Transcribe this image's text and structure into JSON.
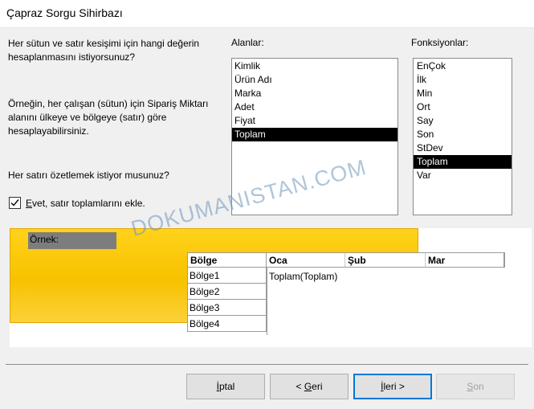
{
  "window": {
    "title": "Çapraz Sorgu Sihirbazı"
  },
  "instructions": {
    "question": "Her sütun ve satır kesişimi için hangi değerin hesaplanmasını istiyorsunuz?",
    "example": "Örneğin, her çalışan (sütun) için Sipariş Miktarı alanını ülkeye ve bölgeye (satır) göre hesaplayabilirsiniz.",
    "summarize_question": "Her satırı özetlemek istiyor musunuz?"
  },
  "fields": {
    "label": "Alanlar:",
    "items": [
      "Kimlik",
      "Ürün Adı",
      "Marka",
      "Adet",
      "Fiyat",
      "Toplam"
    ],
    "selected": "Toplam"
  },
  "functions": {
    "label": "Fonksiyonlar:",
    "items": [
      "EnÇok",
      "İlk",
      "Min",
      "Ort",
      "Say",
      "Son",
      "StDev",
      "Toplam",
      "Var"
    ],
    "selected": "Toplam"
  },
  "row_totals": {
    "checked": true,
    "label_underlined": "E",
    "label_rest": "vet, satır toplamlarını ekle."
  },
  "sample": {
    "label": "Örnek:",
    "row_header": "Bölge",
    "columns": [
      "Oca",
      "Şub",
      "Mar"
    ],
    "rows": [
      "Bölge1",
      "Bölge2",
      "Bölge3",
      "Bölge4"
    ],
    "cell_value": "Toplam(Toplam)"
  },
  "buttons": {
    "cancel": {
      "prefix": "",
      "underline": "İ",
      "rest": "ptal"
    },
    "back": {
      "prefix": "< ",
      "underline": "G",
      "rest": "eri"
    },
    "next": {
      "prefix": "",
      "underline": "İ",
      "rest": "leri >"
    },
    "finish": {
      "prefix": "",
      "underline": "S",
      "rest": "on"
    }
  },
  "watermark": "DOKUMANISTAN.COM"
}
